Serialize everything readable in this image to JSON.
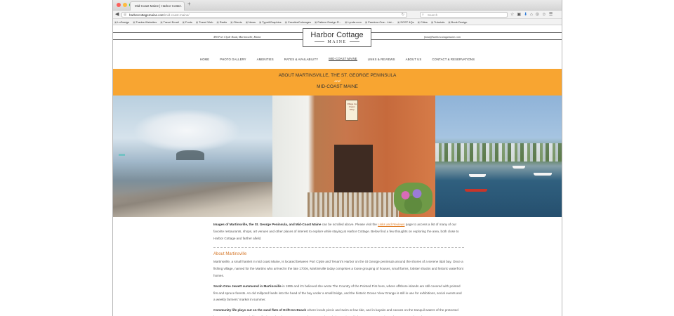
{
  "browser": {
    "tab_title": "Mid-Coast Maine | Harbor Cotta...",
    "tab_close": "×",
    "new_tab": "+",
    "back": "◀",
    "url_host": "harborcottagemaine.com",
    "url_path": "/mid-coast-maine/",
    "reload": "↻",
    "search_placeholder": "Search",
    "toolbar_icons": [
      "☆",
      "▣",
      "⬇",
      "⌂",
      "⊙",
      "☺",
      "☰"
    ],
    "bookmarks": [
      "LoDesign",
      "Trades.Websites",
      "Travel Email",
      "Fonts",
      "Travel Web",
      "Radio",
      "Clients",
      "News",
      "Type&Graphics",
      "CreativeCoImages",
      "Pattern Design R...",
      "Lynda.com",
      "Pandora One - List...",
      "SOST 4Qs",
      "Cities",
      "Tutorials",
      "Book Design"
    ],
    "colors": {
      "close": "#fc605c",
      "minimize": "#fdbc40",
      "zoom": "#34c84a"
    }
  },
  "site": {
    "address": "490 Port Clyde Road, Martinsville, Maine",
    "email": "fiona@harborcottagemaine.com",
    "logo_line1": "Harbor Cottage",
    "logo_line2": "MAINE",
    "nav": [
      "HOME",
      "PHOTO GALLERY",
      "AMENITIES",
      "RATES & AVAILABILITY",
      "MID-COAST MAINE",
      "LINKS & REVIEWS",
      "ABOUT US",
      "CONTACT & RESERVATIONS"
    ],
    "banner": {
      "line1": "ABOUT MARTINSVILLE, THE ST. GEORGE PENINSULA",
      "line2": "and",
      "line3": "MID-COAST MAINE",
      "color": "#f8a531"
    },
    "photos": {
      "sign_text": "Village Ice Cream Shop"
    },
    "intro": {
      "bold": "Images of Martinsville, the St. George Peninsula, and Mid-Coast Maine",
      "pre_link": " can be scrolled above. Please visit the ",
      "link": "Links and Reviews",
      "post_link": " page to access a list of many of our favorite restaurants, shops, art venues and other places of interest to explore while staying at Harbor Cottage. Below find a few thoughts on exploring the area, both close to Harbor Cottage and farther afield."
    },
    "about_heading": "About Martinsville",
    "para1": "Martinsville, a small hamlet in mid coast Maine, is located between Port Clyde and Tenant's Harbor on the St George peninsula around the shores of a serene tidal bay. Once a fishing village, named for the Martins who arrived in the late 1700s, Martinsville today comprises a loose grouping of houses, small farms, lobster shacks and historic waterfront homes.",
    "para2_bold": "Sarah Orne Jewett summered in Martinsville",
    "para2": " in 1895 and it's believed she wrote The Country of the Pointed Firs here, where offshore islands are still covered with pointed firs and spruce forests. An old millpond feeds into the head of the bay under a small bridge, and the historic Ocean View Grange is still in use for exhibitions, social events and a weekly farmers' market in summer.",
    "para3_bold": "Community life plays out on the sand flats of Drift-Inn Beach",
    "para3": " where locals picnic and swim at low tide, and in kayaks and canoes on the tranquil waters of the protected bay. At Hedgerow, our neighbors' lively marketplace, everyone gathers to stock up their pantries with home grown organic produce, prepared meals"
  }
}
